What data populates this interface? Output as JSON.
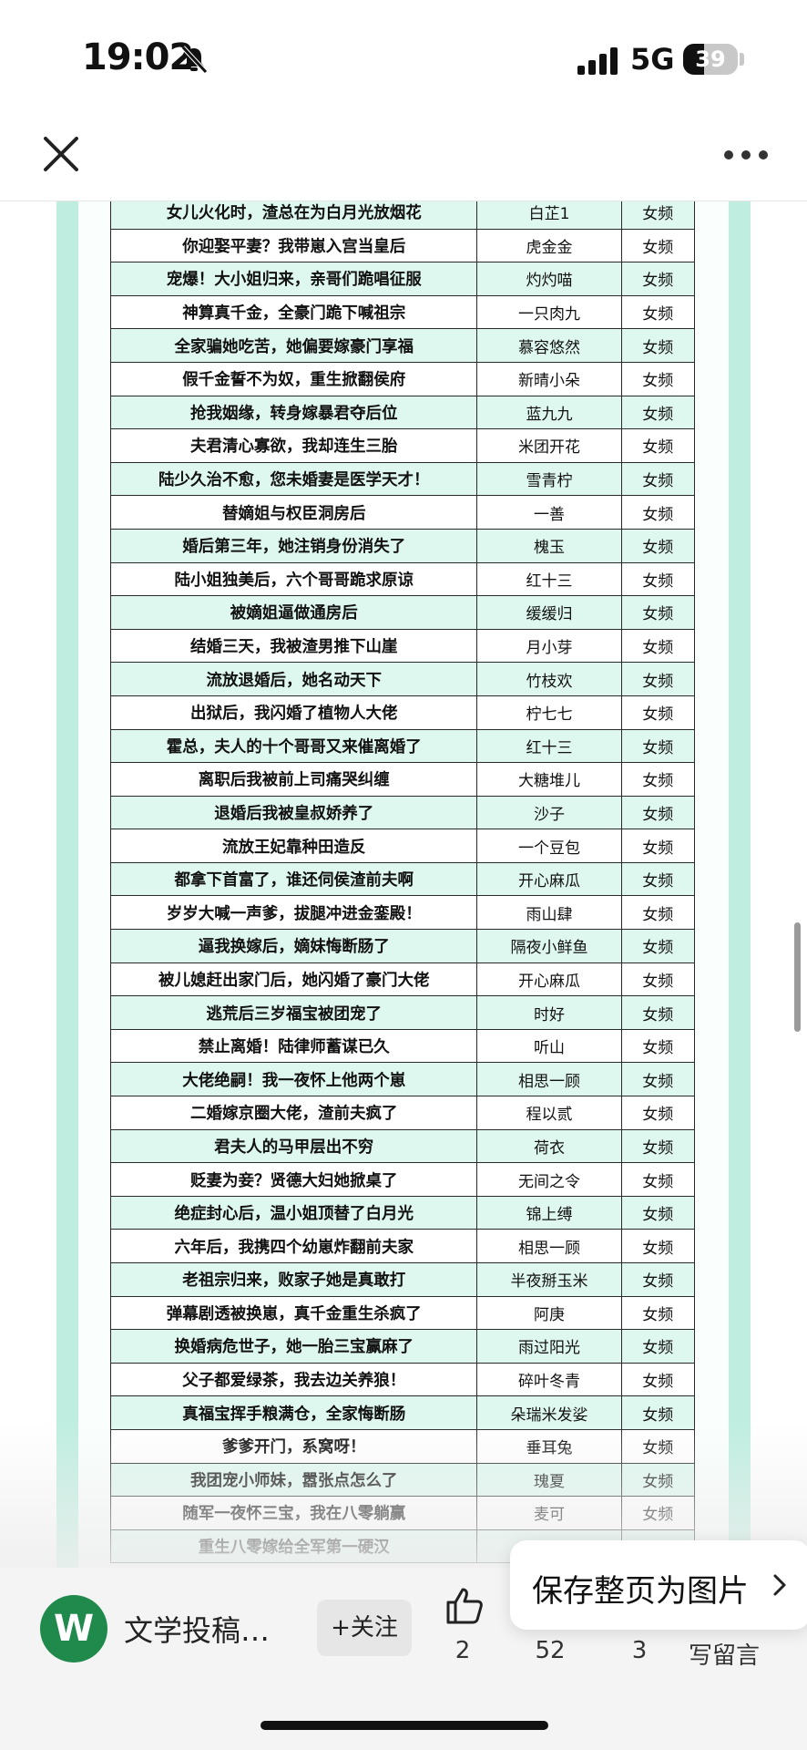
{
  "status_bar": {
    "time": "19:02",
    "network": "5G",
    "battery": "39",
    "battery_level": 0.39
  },
  "icons": {
    "mute": "bell-slash-icon",
    "signal": "signal-bars-icon",
    "close": "close-icon",
    "more": "more-dots-icon",
    "like": "thumbs-up-icon",
    "chevron": "chevron-right-icon"
  },
  "table": {
    "rows": [
      {
        "title": "女儿火化时，渣总在为白月光放烟花",
        "author": "白芷1",
        "category": "女频"
      },
      {
        "title": "你迎娶平妻？我带崽入宫当皇后",
        "author": "虎金金",
        "category": "女频"
      },
      {
        "title": "宠爆！大小姐归来，亲哥们跪唱征服",
        "author": "灼灼喵",
        "category": "女频"
      },
      {
        "title": "神算真千金，全豪门跪下喊祖宗",
        "author": "一只肉九",
        "category": "女频"
      },
      {
        "title": "全家骗她吃苦，她偏要嫁豪门享福",
        "author": "慕容悠然",
        "category": "女频"
      },
      {
        "title": "假千金誓不为奴，重生掀翻侯府",
        "author": "新晴小朵",
        "category": "女频"
      },
      {
        "title": "抢我姻缘，转身嫁暴君夺后位",
        "author": "蓝九九",
        "category": "女频"
      },
      {
        "title": "夫君清心寡欲，我却连生三胎",
        "author": "米团开花",
        "category": "女频"
      },
      {
        "title": "陆少久治不愈，您未婚妻是医学天才！",
        "author": "雪青柠",
        "category": "女频"
      },
      {
        "title": "替嫡姐与权臣洞房后",
        "author": "一善",
        "category": "女频"
      },
      {
        "title": "婚后第三年，她注销身份消失了",
        "author": "槐玉",
        "category": "女频"
      },
      {
        "title": "陆小姐独美后，六个哥哥跪求原谅",
        "author": "红十三",
        "category": "女频"
      },
      {
        "title": "被嫡姐逼做通房后",
        "author": "缓缓归",
        "category": "女频"
      },
      {
        "title": "结婚三天，我被渣男推下山崖",
        "author": "月小芽",
        "category": "女频"
      },
      {
        "title": "流放退婚后，她名动天下",
        "author": "竹枝欢",
        "category": "女频"
      },
      {
        "title": "出狱后，我闪婚了植物人大佬",
        "author": "柠七七",
        "category": "女频"
      },
      {
        "title": "霍总，夫人的十个哥哥又来催离婚了",
        "author": "红十三",
        "category": "女频"
      },
      {
        "title": "离职后我被前上司痛哭纠缠",
        "author": "大糖堆儿",
        "category": "女频"
      },
      {
        "title": "退婚后我被皇叔娇养了",
        "author": "沙子",
        "category": "女频"
      },
      {
        "title": "流放王妃靠种田造反",
        "author": "一个豆包",
        "category": "女频"
      },
      {
        "title": "都拿下首富了，谁还伺侯渣前夫啊",
        "author": "开心麻瓜",
        "category": "女频"
      },
      {
        "title": "岁岁大喊一声爹，拔腿冲进金銮殿！",
        "author": "雨山肆",
        "category": "女频"
      },
      {
        "title": "逼我换嫁后，嫡妹悔断肠了",
        "author": "隔夜小鲜鱼",
        "category": "女频"
      },
      {
        "title": "被儿媳赶出家门后，她闪婚了豪门大佬",
        "author": "开心麻瓜",
        "category": "女频"
      },
      {
        "title": "逃荒后三岁福宝被团宠了",
        "author": "时好",
        "category": "女频"
      },
      {
        "title": "禁止离婚！陆律师蓄谋已久",
        "author": "听山",
        "category": "女频"
      },
      {
        "title": "大佬绝嗣！我一夜怀上他两个崽",
        "author": "相思一顾",
        "category": "女频"
      },
      {
        "title": "二婚嫁京圈大佬，渣前夫疯了",
        "author": "程以贰",
        "category": "女频"
      },
      {
        "title": "君夫人的马甲层出不穷",
        "author": "荷衣",
        "category": "女频"
      },
      {
        "title": "贬妻为妾？贤德大妇她掀桌了",
        "author": "无间之令",
        "category": "女频"
      },
      {
        "title": "绝症封心后，温小姐顶替了白月光",
        "author": "锦上缚",
        "category": "女频"
      },
      {
        "title": "六年后，我携四个幼崽炸翻前夫家",
        "author": "相思一顾",
        "category": "女频"
      },
      {
        "title": "老祖宗归来，败家子她是真敢打",
        "author": "半夜掰玉米",
        "category": "女频"
      },
      {
        "title": "弹幕剧透被换崽，真千金重生杀疯了",
        "author": "阿庚",
        "category": "女频"
      },
      {
        "title": "换婚病危世子，她一胎三宝赢麻了",
        "author": "雨过阳光",
        "category": "女频"
      },
      {
        "title": "父子都爱绿茶，我去边关养狼！",
        "author": "碎叶冬青",
        "category": "女频"
      },
      {
        "title": "真福宝挥手粮满仓，全家悔断肠",
        "author": "朵瑞米发娑",
        "category": "女频"
      },
      {
        "title": "爹爹开门，系窝呀！",
        "author": "垂耳兔",
        "category": "女频"
      },
      {
        "title": "我团宠小师妹，嚣张点怎么了",
        "author": "瑰夏",
        "category": "女频"
      },
      {
        "title": "随军一夜怀三宝，我在八零躺赢",
        "author": "麦可",
        "category": "女频"
      },
      {
        "title": "重生八零嫁给全军第一硬汉",
        "author": "",
        "category": ""
      }
    ]
  },
  "bottom_bar": {
    "account_name": "文学投稿…",
    "avatar_letter": "W",
    "follow_label": "+关注",
    "like_count": "2",
    "second_count": "52",
    "third_count": "3",
    "comment_label": "写留言",
    "save_popup_label": "保存整页为图片"
  },
  "colors": {
    "mint_frame": "#bfeee0",
    "row_alt": "#dff8ef",
    "avatar_green": "#1f8a4c"
  }
}
